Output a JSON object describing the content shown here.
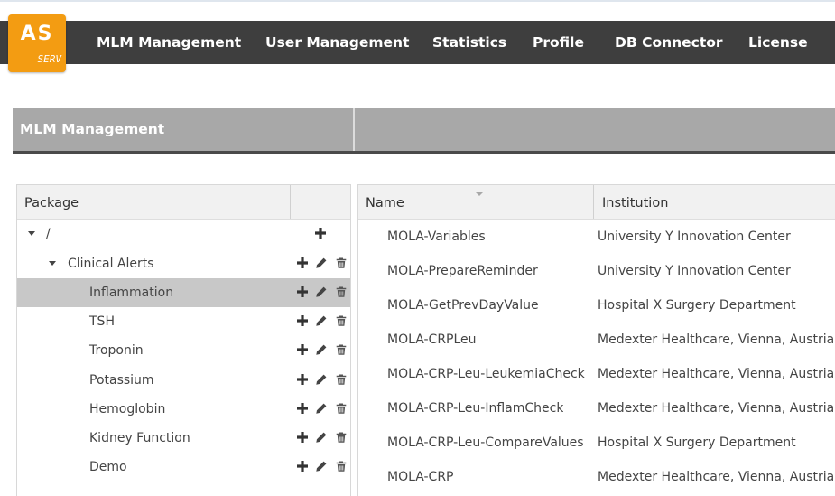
{
  "logo": {
    "line1": "AS",
    "line2": "SERV"
  },
  "colors": {
    "nav_bg": "#3e3e3e",
    "logo_accent": "#f39c12",
    "section_header_bg": "#a8a8a8",
    "selected_row_bg": "#c8c8c8"
  },
  "nav": {
    "items": [
      {
        "label": "MLM Management",
        "icon": ""
      },
      {
        "label": "User Management",
        "icon": ""
      },
      {
        "label": "Statistics",
        "icon": ""
      },
      {
        "label": "Profile",
        "icon": ""
      },
      {
        "label": "DB Connector",
        "icon": ""
      },
      {
        "label": "License",
        "icon": ""
      }
    ]
  },
  "section": {
    "title": "MLM Management"
  },
  "packages": {
    "header": "Package",
    "tree": [
      {
        "label": "/",
        "expanded": true,
        "actions": [
          "plus-icon"
        ]
      },
      {
        "label": "Clinical Alerts",
        "expanded": true,
        "actions": [
          "plus-icon",
          "pencil-icon",
          "trash-icon"
        ]
      },
      {
        "label": "Inflammation",
        "selected": true,
        "actions": [
          "plus-icon",
          "pencil-icon",
          "trash-icon"
        ]
      },
      {
        "label": "TSH",
        "actions": [
          "plus-icon",
          "pencil-icon",
          "trash-icon"
        ]
      },
      {
        "label": "Troponin",
        "actions": [
          "plus-icon",
          "pencil-icon",
          "trash-icon"
        ]
      },
      {
        "label": "Potassium",
        "actions": [
          "plus-icon",
          "pencil-icon",
          "trash-icon"
        ]
      },
      {
        "label": "Hemoglobin",
        "actions": [
          "plus-icon",
          "pencil-icon",
          "trash-icon"
        ]
      },
      {
        "label": "Kidney Function",
        "actions": [
          "plus-icon",
          "pencil-icon",
          "trash-icon"
        ]
      },
      {
        "label": "Demo",
        "actions": [
          "plus-icon",
          "pencil-icon",
          "trash-icon"
        ]
      }
    ]
  },
  "mlm_table": {
    "columns": [
      "Name",
      "Institution"
    ],
    "sort_indicator": "descending-arrow-icon",
    "rows": [
      {
        "name": "MOLA-Variables",
        "institution": "University Y Innovation Center"
      },
      {
        "name": "MOLA-PrepareReminder",
        "institution": "University Y Innovation Center"
      },
      {
        "name": "MOLA-GetPrevDayValue",
        "institution": "Hospital X Surgery Department"
      },
      {
        "name": "MOLA-CRPLeu",
        "institution": "Medexter Healthcare, Vienna, Austria"
      },
      {
        "name": "MOLA-CRP-Leu-LeukemiaCheck",
        "institution": "Medexter Healthcare, Vienna, Austria"
      },
      {
        "name": "MOLA-CRP-Leu-InflamCheck",
        "institution": "Medexter Healthcare, Vienna, Austria"
      },
      {
        "name": "MOLA-CRP-Leu-CompareValues",
        "institution": "Hospital X Surgery Department"
      },
      {
        "name": "MOLA-CRP",
        "institution": "Medexter Healthcare, Vienna, Austria"
      }
    ]
  }
}
